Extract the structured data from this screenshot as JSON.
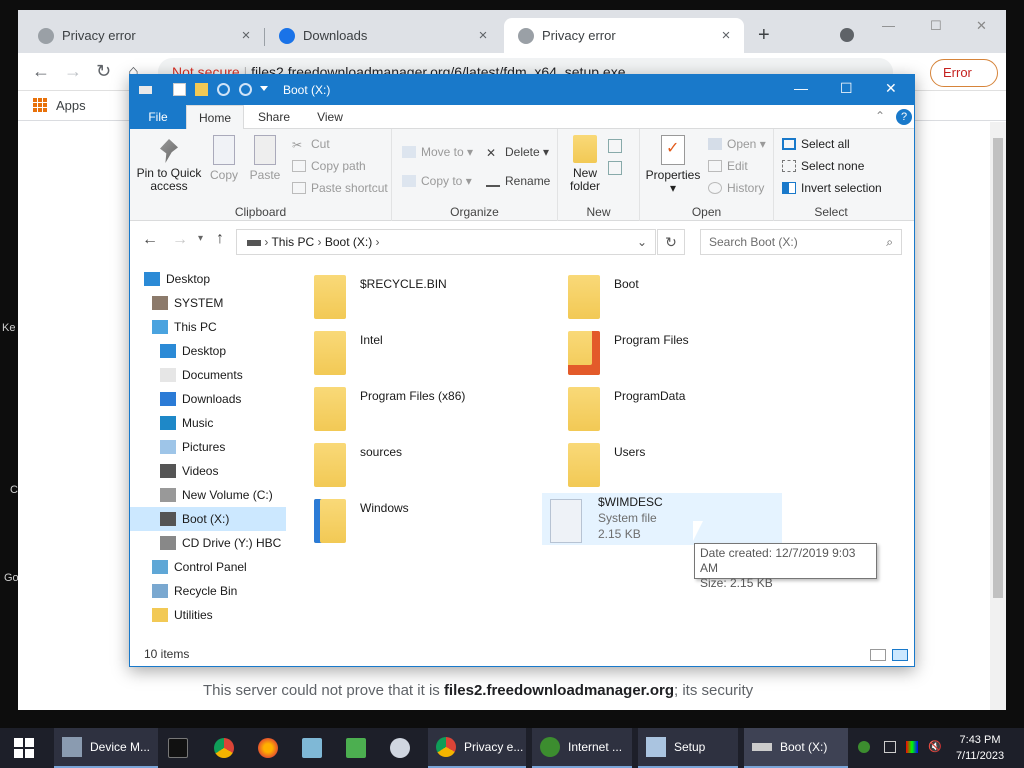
{
  "desktop": {
    "fragments": [
      "Ke",
      "C",
      "Go"
    ]
  },
  "browser": {
    "tabs": [
      {
        "title": "Privacy error",
        "close": "×"
      },
      {
        "title": "Downloads",
        "close": "×"
      },
      {
        "title": "Privacy error",
        "close": "×"
      }
    ],
    "new_tab": "+",
    "window_controls": {
      "minimize": "—",
      "maximize": "☐",
      "close": "✕"
    },
    "nav": {
      "back": "←",
      "forward": "→",
      "reload": "↻",
      "home": "⌂"
    },
    "omnibox": {
      "security_label": "Not secure",
      "url": "files2.freedownloadmanager.org/6/latest/fdm_x64_setup.exe"
    },
    "error_button": "Error",
    "bookmarks": {
      "apps_label": "Apps"
    },
    "page_text_prefix": "This server could not prove that it is ",
    "page_text_bold": "files2.freedownloadmanager.org",
    "page_text_suffix": "; its security"
  },
  "explorer": {
    "title": "Boot (X:)",
    "ribbon_tabs": {
      "file": "File",
      "home": "Home",
      "share": "Share",
      "view": "View"
    },
    "clipboard": {
      "pin": "Pin to Quick access",
      "copy": "Copy",
      "paste": "Paste",
      "cut": "Cut",
      "copy_path": "Copy path",
      "paste_shortcut": "Paste shortcut",
      "label": "Clipboard"
    },
    "organize": {
      "move_to": "Move to",
      "copy_to": "Copy to",
      "delete": "Delete",
      "rename": "Rename",
      "label": "Organize"
    },
    "new_group": {
      "new_folder": "New folder",
      "label": "New"
    },
    "open_group": {
      "properties": "Properties",
      "open": "Open",
      "edit": "Edit",
      "history": "History",
      "label": "Open"
    },
    "select_group": {
      "select_all": "Select all",
      "select_none": "Select none",
      "invert": "Invert selection",
      "label": "Select"
    },
    "breadcrumb": {
      "this_pc": "This PC",
      "drive": "Boot (X:)"
    },
    "search_placeholder": "Search Boot (X:)",
    "nav_items": [
      {
        "label": "Desktop"
      },
      {
        "label": "SYSTEM"
      },
      {
        "label": "This PC"
      },
      {
        "label": "Desktop"
      },
      {
        "label": "Documents"
      },
      {
        "label": "Downloads"
      },
      {
        "label": "Music"
      },
      {
        "label": "Pictures"
      },
      {
        "label": "Videos"
      },
      {
        "label": "New Volume (C:)"
      },
      {
        "label": "Boot (X:)"
      },
      {
        "label": "CD Drive (Y:) HBC"
      },
      {
        "label": "Control Panel"
      },
      {
        "label": "Recycle Bin"
      },
      {
        "label": "Utilities"
      }
    ],
    "items": [
      {
        "name": "$RECYCLE.BIN"
      },
      {
        "name": "Boot"
      },
      {
        "name": "Intel"
      },
      {
        "name": "Program Files"
      },
      {
        "name": "Program Files (x86)"
      },
      {
        "name": "ProgramData"
      },
      {
        "name": "sources"
      },
      {
        "name": "Users"
      },
      {
        "name": "Windows"
      },
      {
        "name": "$WIMDESC",
        "type": "System file",
        "size": "2.15 KB"
      }
    ],
    "tooltip": {
      "date_created": "Date created: 12/7/2019 9:03 AM",
      "size": "Size: 2.15 KB"
    },
    "status": "10 items"
  },
  "taskbar": {
    "apps": [
      {
        "label": "Device M..."
      },
      {
        "label": "Privacy e..."
      },
      {
        "label": "Internet ..."
      },
      {
        "label": "Setup"
      },
      {
        "label": "Boot (X:)"
      }
    ],
    "clock": {
      "time": "7:43 PM",
      "date": "7/11/2023"
    }
  },
  "colors": {
    "accent": "#1979ca",
    "folder": "#f2c955",
    "taskbar": "#1d1f29",
    "error": "#d93025"
  }
}
